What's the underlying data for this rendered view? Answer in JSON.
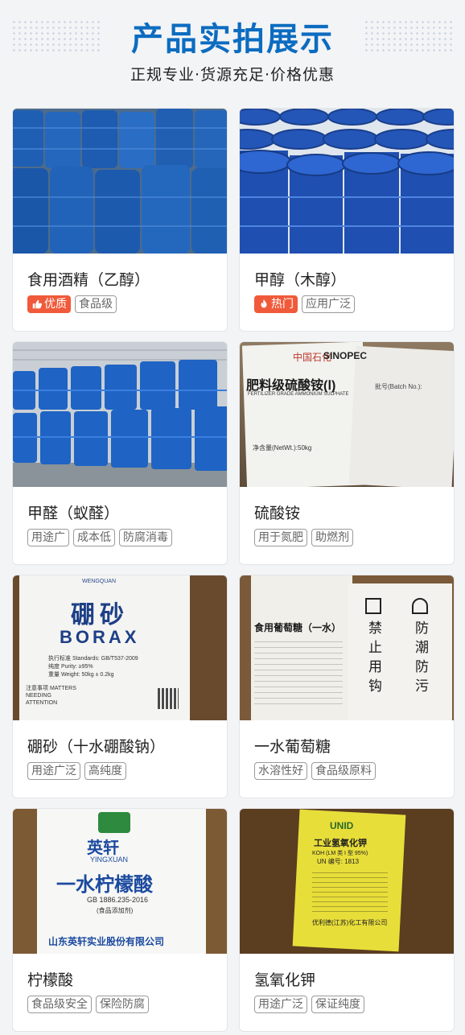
{
  "header": {
    "title": "产品实拍展示",
    "subtitle": "正规专业·货源充足·价格优惠"
  },
  "products": [
    {
      "name": "食用酒精（乙醇）",
      "badge": "优质",
      "badge_icon": "thumbs-up-icon",
      "tags": [
        "食品级"
      ]
    },
    {
      "name": "甲醇（木醇）",
      "badge": "热门",
      "badge_icon": "flame-icon",
      "tags": [
        "应用广泛"
      ]
    },
    {
      "name": "甲醛（蚁醛）",
      "tags": [
        "用途广",
        "成本低",
        "防腐消毒"
      ]
    },
    {
      "name": "硫酸铵",
      "tags": [
        "用于氮肥",
        "助燃剂"
      ]
    },
    {
      "name": "硼砂（十水硼酸钠）",
      "tags": [
        "用途广泛",
        "高纯度"
      ]
    },
    {
      "name": "一水葡萄糖",
      "tags": [
        "水溶性好",
        "食品级原料"
      ]
    },
    {
      "name": "柠檬酸",
      "tags": [
        "食品级安全",
        "保险防腐"
      ]
    },
    {
      "name": "氢氧化钾",
      "tags": [
        "用途广泛",
        "保证纯度"
      ]
    }
  ],
  "photo_text": {
    "sulfate": {
      "brand_cn": "中国石化",
      "brand_en": "SINOPEC",
      "product": "肥料级硫酸铵(Ⅰ)",
      "product_en": "FERTILIZER GRADE AMMONIUM SULPHATE",
      "batch": "批号(Batch No.):",
      "weight": "净含量(NetWt.):50kg"
    },
    "borax": {
      "brand": "WENGQUAN",
      "cn": "硼砂",
      "en": "BORAX",
      "std": "执行标准 Standards: GB/T537-2009",
      "purity": "纯度 Purity: ≥95%",
      "weight": "重量 Weight: 50kg ± 0.2kg",
      "notice": "注意事项 MATTERS NEEDING ATTENTION"
    },
    "glucose": {
      "label": "食用葡萄糖（一水）",
      "side": [
        "禁",
        "止",
        "用",
        "钩"
      ],
      "side2": [
        "防",
        "潮",
        "防",
        "污"
      ]
    },
    "citric": {
      "brand": "英轩",
      "brand_en": "YINGXUAN",
      "name": "一水柠檬酸",
      "std": "GB 1886.235-2016",
      "note": "(食品添加剂)",
      "company": "山东英轩实业股份有限公司"
    },
    "koh": {
      "brand": "UNID",
      "name": "工业氢氧化钾",
      "formula": "KOH (LM 类 I 型 95%)",
      "un": "UN 编号: 1813",
      "company": "优利德(江苏)化工有限公司"
    }
  },
  "colors": {
    "accent": "#0c6cc0",
    "hot_badge": "#f05a3a"
  }
}
